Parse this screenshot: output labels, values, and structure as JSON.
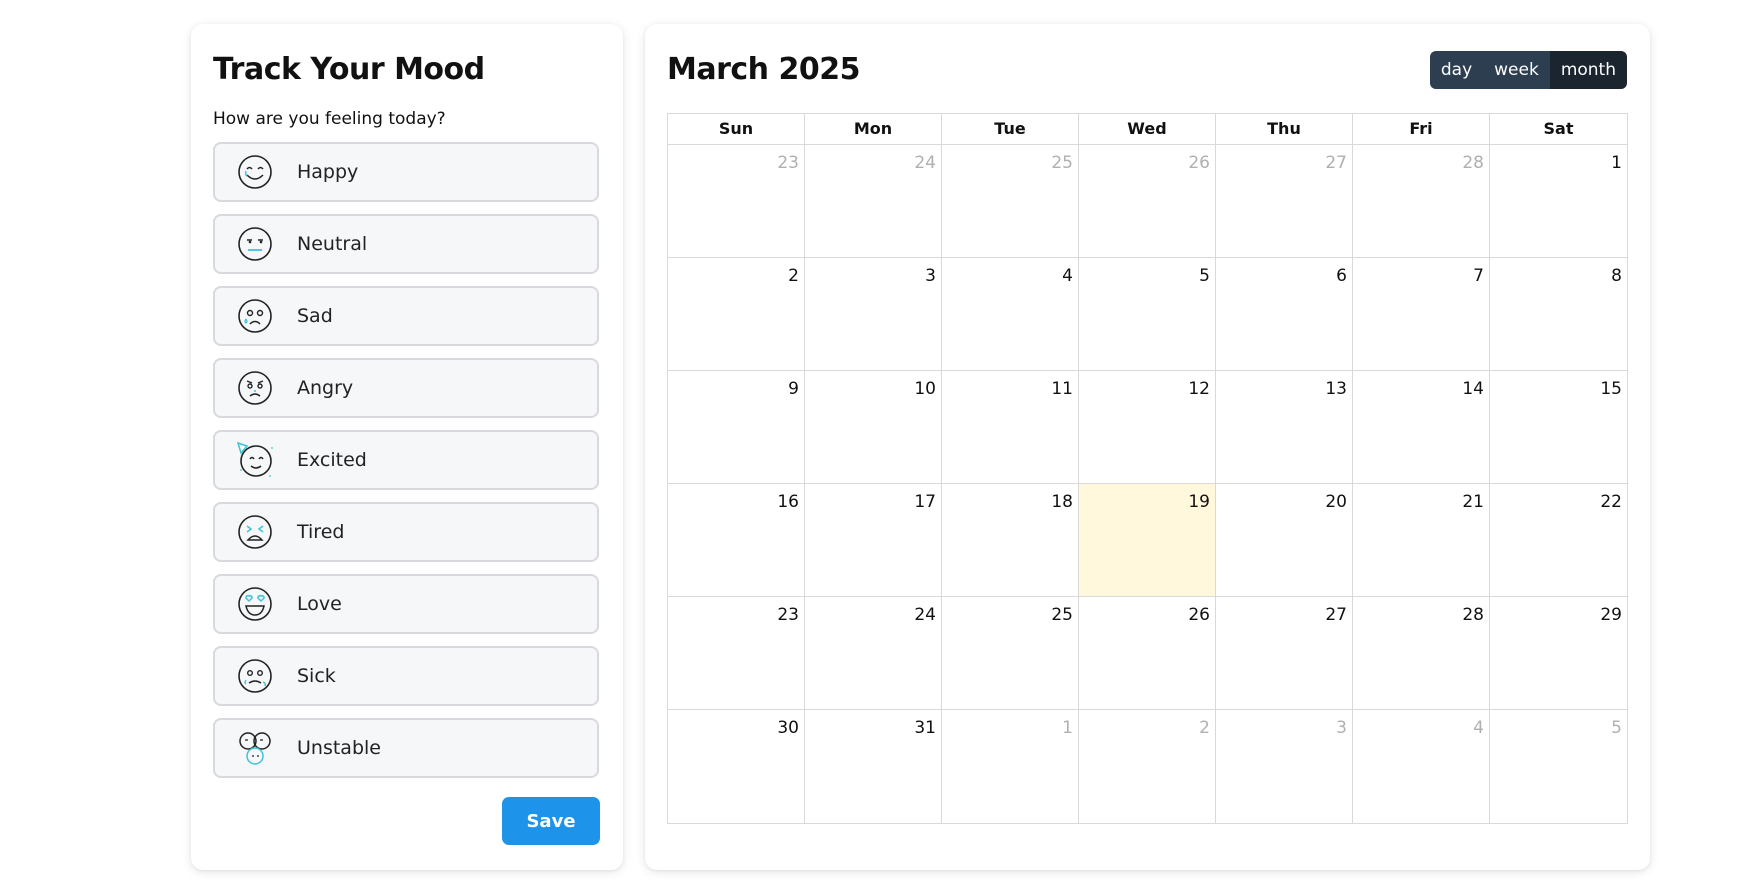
{
  "mood_panel": {
    "title": "Track Your Mood",
    "question": "How are you feeling today?",
    "moods": [
      {
        "label": "Happy",
        "icon": "happy-face-icon"
      },
      {
        "label": "Neutral",
        "icon": "neutral-face-icon"
      },
      {
        "label": "Sad",
        "icon": "sad-face-icon"
      },
      {
        "label": "Angry",
        "icon": "angry-face-icon"
      },
      {
        "label": "Excited",
        "icon": "excited-face-icon"
      },
      {
        "label": "Tired",
        "icon": "tired-face-icon"
      },
      {
        "label": "Love",
        "icon": "love-face-icon"
      },
      {
        "label": "Sick",
        "icon": "sick-face-icon"
      },
      {
        "label": "Unstable",
        "icon": "unstable-face-icon"
      }
    ],
    "save_label": "Save"
  },
  "calendar": {
    "title": "March 2025",
    "views": [
      "day",
      "week",
      "month"
    ],
    "active_view": "month",
    "weekdays": [
      "Sun",
      "Mon",
      "Tue",
      "Wed",
      "Thu",
      "Fri",
      "Sat"
    ],
    "weeks": [
      [
        {
          "d": "23",
          "other": true
        },
        {
          "d": "24",
          "other": true
        },
        {
          "d": "25",
          "other": true
        },
        {
          "d": "26",
          "other": true
        },
        {
          "d": "27",
          "other": true
        },
        {
          "d": "28",
          "other": true
        },
        {
          "d": "1"
        }
      ],
      [
        {
          "d": "2"
        },
        {
          "d": "3"
        },
        {
          "d": "4"
        },
        {
          "d": "5"
        },
        {
          "d": "6"
        },
        {
          "d": "7"
        },
        {
          "d": "8"
        }
      ],
      [
        {
          "d": "9"
        },
        {
          "d": "10"
        },
        {
          "d": "11"
        },
        {
          "d": "12"
        },
        {
          "d": "13"
        },
        {
          "d": "14"
        },
        {
          "d": "15"
        }
      ],
      [
        {
          "d": "16"
        },
        {
          "d": "17"
        },
        {
          "d": "18"
        },
        {
          "d": "19",
          "today": true
        },
        {
          "d": "20"
        },
        {
          "d": "21"
        },
        {
          "d": "22"
        }
      ],
      [
        {
          "d": "23"
        },
        {
          "d": "24"
        },
        {
          "d": "25"
        },
        {
          "d": "26"
        },
        {
          "d": "27"
        },
        {
          "d": "28"
        },
        {
          "d": "29"
        }
      ],
      [
        {
          "d": "30"
        },
        {
          "d": "31"
        },
        {
          "d": "1",
          "other": true
        },
        {
          "d": "2",
          "other": true
        },
        {
          "d": "3",
          "other": true
        },
        {
          "d": "4",
          "other": true
        },
        {
          "d": "5",
          "other": true
        }
      ]
    ],
    "colors": {
      "today_bg": "#fff8dd",
      "switch_bg": "#2c3e50",
      "switch_active": "#1a252f"
    }
  },
  "colors": {
    "accent": "#1e93ea",
    "icon_accent": "#3cc4d8"
  }
}
